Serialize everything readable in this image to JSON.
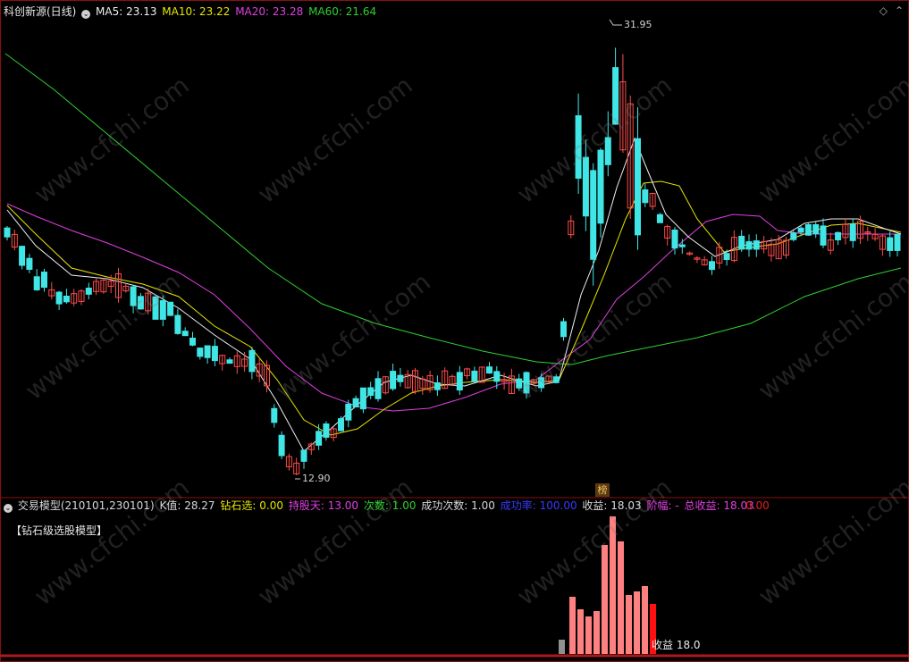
{
  "header": {
    "stock_title": "科创新源(日线)",
    "ma5_label": "MA5:",
    "ma5_value": "23.13",
    "ma10_label": "MA10:",
    "ma10_value": "23.22",
    "ma20_label": "MA20:",
    "ma20_value": "23.28",
    "ma60_label": "MA60:",
    "ma60_value": "21.64",
    "colors": {
      "ma5": "#f0f0f0",
      "ma10": "#e6e600",
      "ma20": "#e040e0",
      "ma60": "#30d030"
    }
  },
  "chart": {
    "high_label": "31.95",
    "low_label": "12.90",
    "rank_badge": "榜",
    "colors": {
      "up": "#ff4a4a",
      "down": "#40e6e6",
      "grid_border": "#8a1010"
    }
  },
  "indicator": {
    "name": "交易模型(210101,230101)",
    "k_label": "K值:",
    "k_value": "28.27",
    "zs_label": "钻石选:",
    "zs_value": "0.00",
    "hold_label": "持股天:",
    "hold_value": "13.00",
    "count_label": "次数:",
    "count_value": "1.00",
    "success_label": "成功次数:",
    "success_value": "1.00",
    "rate_label": "成功率:",
    "rate_value": "100.00",
    "profit_label": "收益:",
    "profit_value": "18.03",
    "amp_label": "阶幅:",
    "amp_value": "-",
    "total_label": "总收益:",
    "total_value": "18.03",
    "extra_value": "0.00",
    "model_title": "【钻石级选股模型】",
    "bar_note": "收益 18.0"
  },
  "watermark": "www.cfchi.com"
}
